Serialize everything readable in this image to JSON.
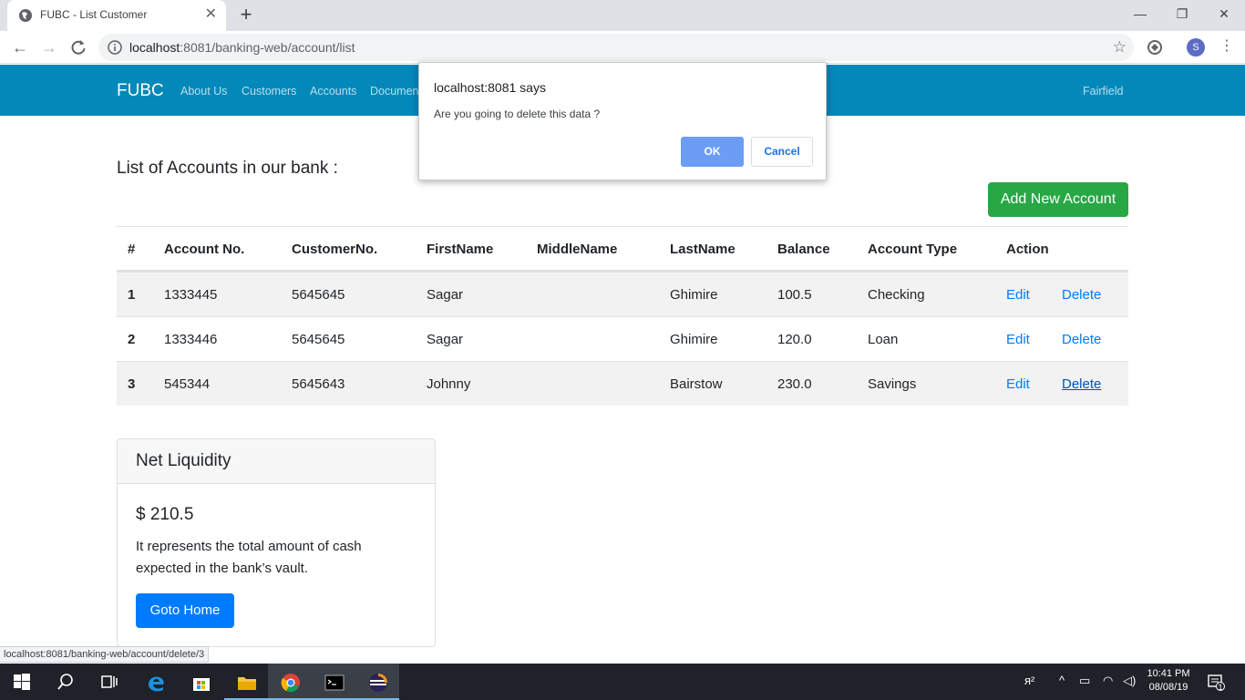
{
  "browser": {
    "tab_title": "FUBC - List Customer",
    "new_tab": "+",
    "url_host": "localhost",
    "url_path": ":8081/banking-web/account/list",
    "profile_initial": "S"
  },
  "nav": {
    "brand": "FUBC",
    "links": [
      "About Us",
      "Customers",
      "Accounts",
      "Documen"
    ],
    "right": "Fairfield"
  },
  "page": {
    "heading": "List of Accounts in our bank :",
    "add_button": "Add New Account"
  },
  "table": {
    "headers": [
      "#",
      "Account No.",
      "CustomerNo.",
      "FirstName",
      "MiddleName",
      "LastName",
      "Balance",
      "Account Type",
      "Action"
    ],
    "rows": [
      {
        "num": "1",
        "account_no": "1333445",
        "customer_no": "5645645",
        "first": "Sagar",
        "middle": "",
        "last": "Ghimire",
        "balance": "100.5",
        "type": "Checking",
        "edit": "Edit",
        "delete": "Delete"
      },
      {
        "num": "2",
        "account_no": "1333446",
        "customer_no": "5645645",
        "first": "Sagar",
        "middle": "",
        "last": "Ghimire",
        "balance": "120.0",
        "type": "Loan",
        "edit": "Edit",
        "delete": "Delete"
      },
      {
        "num": "3",
        "account_no": "545344",
        "customer_no": "5645643",
        "first": "Johnny",
        "middle": "",
        "last": "Bairstow",
        "balance": "230.0",
        "type": "Savings",
        "edit": "Edit",
        "delete": "Delete"
      }
    ]
  },
  "card": {
    "title": "Net Liquidity",
    "value": "$ 210.5",
    "text": "It represents the total amount of cash expected in the bank’s vault.",
    "button": "Goto Home"
  },
  "status_url": "localhost:8081/banking-web/account/delete/3",
  "dialog": {
    "title": "localhost:8081 says",
    "message": "Are you going to delete this data ?",
    "ok": "OK",
    "cancel": "Cancel"
  },
  "taskbar": {
    "time": "10:41 PM",
    "date": "08/08/19",
    "notification_count": "1"
  },
  "colors": {
    "navbar": "#0288b9",
    "success": "#28a745",
    "primary": "#007bff",
    "dialog_ok": "#6b9df7"
  }
}
